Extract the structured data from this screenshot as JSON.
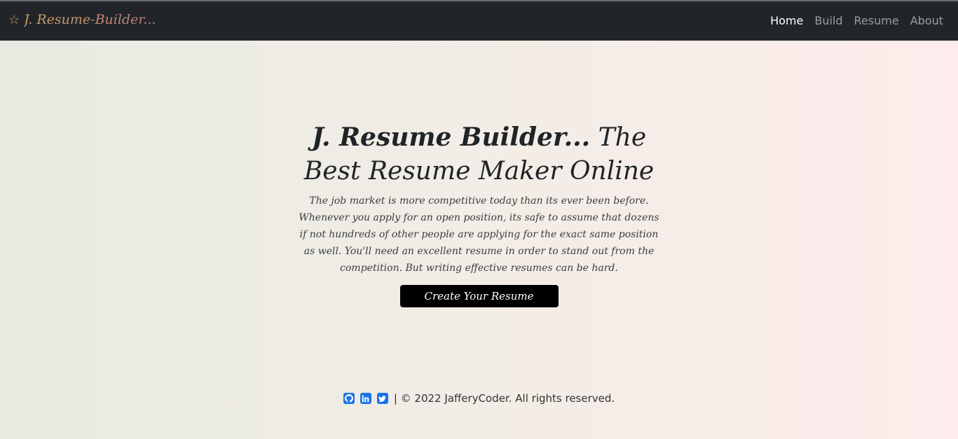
{
  "navbar": {
    "brand": "J. Resume-Builder...",
    "links": [
      {
        "label": "Home",
        "active": true
      },
      {
        "label": "Build",
        "active": false
      },
      {
        "label": "Resume",
        "active": false
      },
      {
        "label": "About",
        "active": false
      }
    ]
  },
  "hero": {
    "title_bold": "J. Resume Builder...",
    "title_rest": "The Best Resume Maker Online",
    "description": "The job market is more competitive today than its ever been before. Whenever you apply for an open position, its safe to assume that dozens if not hundreds of other people are applying for the exact same position as well. You'll need an excellent resume in order to stand out from the competition. But writing effective resumes can be hard.",
    "cta_label": "Create Your Resume"
  },
  "footer": {
    "copyright": "| © 2022 JafferyCoder. All rights reserved.",
    "social_icons": [
      "github-icon",
      "linkedin-icon",
      "twitter-icon"
    ]
  },
  "colors": {
    "navbar_bg": "#212529",
    "brand": "#c9a26a",
    "social_icon": "#1a73e8",
    "cta_bg": "#000000"
  }
}
